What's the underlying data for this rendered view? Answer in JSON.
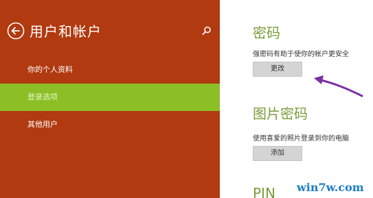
{
  "sidebar": {
    "title": "用户和帐户",
    "back_icon": "back-arrow-icon",
    "search_icon": "search-icon",
    "background": "#b13a10",
    "items": [
      {
        "label": "你的个人资料",
        "selected": false
      },
      {
        "label": "登录选项",
        "selected": true
      },
      {
        "label": "其他用户",
        "selected": false
      }
    ],
    "selected_color": "#8cbf26"
  },
  "content": {
    "password": {
      "title": "密码",
      "description": "强密码有助于使你的帐户更安全",
      "button_label": "更改"
    },
    "picture_password": {
      "title": "图片密码",
      "description": "使用喜爱的照片登录到你的电脑",
      "button_label": "添加"
    },
    "pin": {
      "title": "PIN"
    },
    "accent_color": "#7a9d3a"
  },
  "annotation": {
    "arrow_color": "#7b2fa6"
  },
  "watermark": {
    "text": "win7w.com"
  }
}
